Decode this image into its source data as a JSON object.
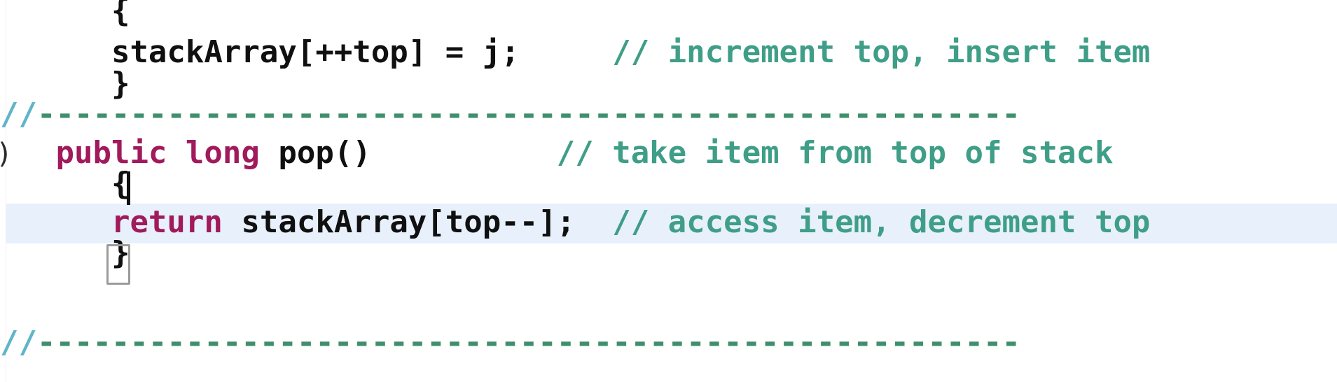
{
  "editor": {
    "background_color": "#ffffff",
    "current_line_highlight_color": "#e8f0fc",
    "caret_color": "#111111",
    "bracket_match_outline_color": "#9b9b9b",
    "colors": {
      "keyword": "#a01a5c",
      "plain": "#101010",
      "comment": "#3f9e87",
      "comment_slashes": "#5fb5c9",
      "comment_dashes": "#3f8f6e"
    },
    "fold_marker_glyph": ")"
  },
  "lines": [
    {
      "id": "line-open-brace-push",
      "indent": "      ",
      "code": "{",
      "comment": "",
      "highlighted": false
    },
    {
      "id": "line-stackarray-assign",
      "indent": "      ",
      "code": "stackArray[++top] = j;",
      "comment": "// increment top, insert item",
      "comment_gap": "     ",
      "highlighted": false
    },
    {
      "id": "line-close-brace-push",
      "indent": "      ",
      "code": "}",
      "comment": "",
      "highlighted": false
    },
    {
      "id": "line-divider-1",
      "indent": "",
      "slashes": "//",
      "dashes": "-----------------------------------------------------",
      "highlighted": false
    },
    {
      "id": "line-public-long-pop",
      "indent": "   ",
      "keyword": "public long ",
      "code": "pop()",
      "comment": "// take item from top of stack",
      "comment_gap": "          ",
      "highlighted": false
    },
    {
      "id": "line-open-brace-pop",
      "indent": "      ",
      "code": "{",
      "comment": "",
      "highlighted": true
    },
    {
      "id": "line-return-stackarray",
      "indent": "      ",
      "keyword": "return ",
      "code": "stackArray[top--];",
      "comment": "// access item, decrement top",
      "comment_gap": "  ",
      "highlighted": false
    },
    {
      "id": "line-close-brace-pop",
      "indent": "      ",
      "code": "}",
      "comment": "",
      "highlighted": false
    },
    {
      "id": "line-divider-2",
      "indent": "",
      "slashes": "//",
      "dashes": "-----------------------------------------------------",
      "highlighted": false
    }
  ]
}
